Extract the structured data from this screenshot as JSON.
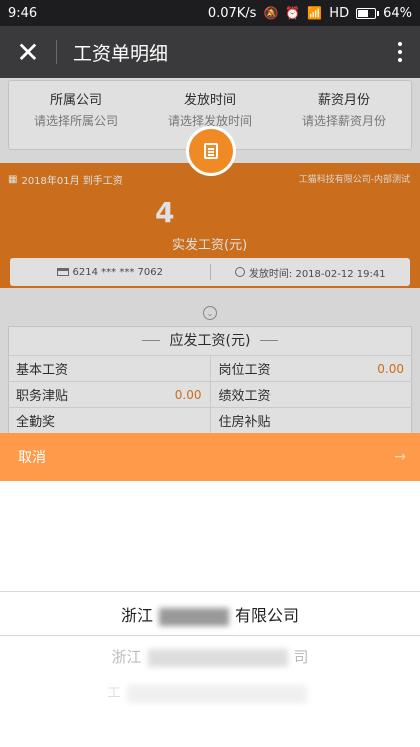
{
  "status_bar": {
    "time": "9:46",
    "speed": "0.07K/s",
    "network": "HD",
    "battery": "64%",
    "battery_level": 0.64
  },
  "nav": {
    "title": "工资单明细"
  },
  "filters": [
    {
      "label": "所属公司",
      "placeholder": "请选择所属公司"
    },
    {
      "label": "发放时间",
      "placeholder": "请选择发放时间"
    },
    {
      "label": "薪资月份",
      "placeholder": "请选择薪资月份"
    }
  ],
  "summary": {
    "period": "2018年01月 到手工资",
    "company": "工猫科技有限公司-内部测试",
    "amount": "4",
    "amount_caption": "实发工资(元)",
    "card": "6214 *** *** 7062",
    "pay_time": "发放时间: 2018-02-12 19:41"
  },
  "payable": {
    "title": "应发工资(元)",
    "rows": [
      {
        "left": "基本工资",
        "left_value": "",
        "right": "岗位工资",
        "right_value": "0.00"
      },
      {
        "left": "职务津贴",
        "left_value": "0.00",
        "right": "绩效工资",
        "right_value": ""
      },
      {
        "left": "全勤奖",
        "left_value": "",
        "right": "住房补贴",
        "right_value": ""
      }
    ]
  },
  "picker": {
    "cancel": "取消",
    "confirm": "→",
    "options": [
      "浙江",
      "有限公司",
      "浙江",
      "司",
      "工"
    ]
  }
}
